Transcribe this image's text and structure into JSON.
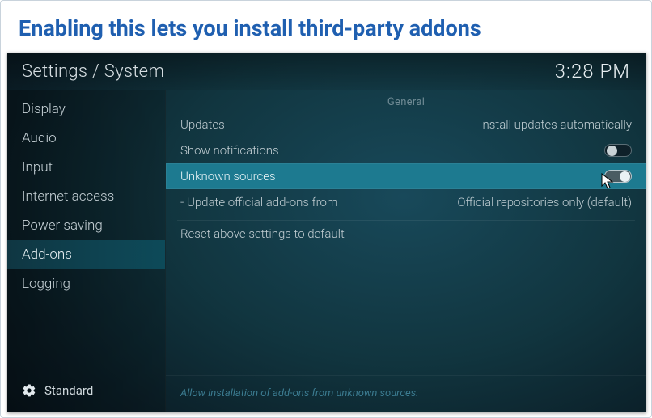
{
  "caption": "Enabling this lets you install third-party addons",
  "header": {
    "breadcrumb": "Settings / System",
    "clock": "3:28 PM"
  },
  "sidebar": {
    "items": [
      {
        "label": "Display"
      },
      {
        "label": "Audio"
      },
      {
        "label": "Input"
      },
      {
        "label": "Internet access"
      },
      {
        "label": "Power saving"
      },
      {
        "label": "Add-ons",
        "active": true
      },
      {
        "label": "Logging"
      }
    ],
    "level_label": "Standard"
  },
  "content": {
    "section_title": "General",
    "rows": [
      {
        "label": "Updates",
        "value": "Install updates automatically",
        "type": "select"
      },
      {
        "label": "Show notifications",
        "type": "toggle",
        "on": false
      },
      {
        "label": "Unknown sources",
        "type": "toggle",
        "on": true,
        "selected": true
      },
      {
        "label": "- Update official add-ons from",
        "value": "Official repositories only (default)",
        "type": "select"
      },
      {
        "label": "Reset above settings to default",
        "type": "action"
      }
    ],
    "help_text": "Allow installation of add-ons from unknown sources."
  }
}
